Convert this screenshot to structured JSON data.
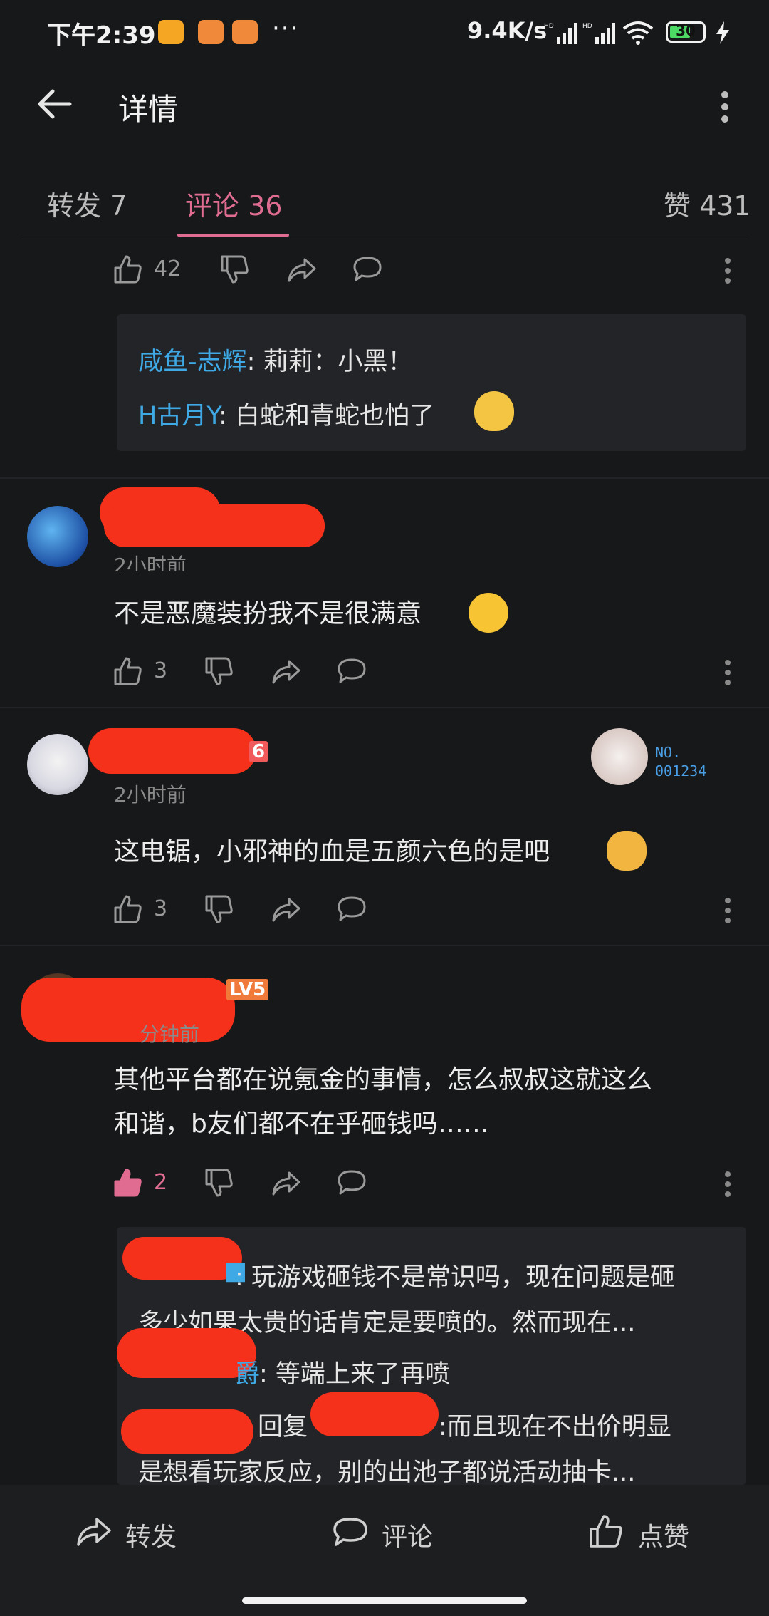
{
  "status_bar": {
    "time": "下午2:39",
    "dots": "···",
    "network_speed": "9.4K/s",
    "battery": "30"
  },
  "header": {
    "title": "详情",
    "back_icon": "arrow-left-icon",
    "more_icon": "more-vertical-icon"
  },
  "tabs": {
    "forward": "转发 7",
    "comments": "评论 36",
    "likes": "赞 431"
  },
  "top_comment": {
    "like_count": "42",
    "replies": [
      {
        "name": "咸鱼-志辉",
        "text": ": 莉莉：小黑！"
      },
      {
        "name": "H古月Y",
        "text": ": 白蛇和青蛇也怕了"
      }
    ]
  },
  "comments": [
    {
      "time": "2小时前",
      "time_visible_part": "2小时前",
      "text": "不是恶魔装扮我不是很满意",
      "like_count": "3",
      "liked": false
    },
    {
      "time": "2小时前",
      "level": "6",
      "badge_no": "NO.",
      "badge_id": "001234",
      "text": "这电锯，小邪神的血是五颜六色的是吧",
      "like_count": "3",
      "liked": false
    },
    {
      "time": "分钟前",
      "level": "LV5",
      "text_line1": "其他平台都在说氪金的事情，怎么叔叔这就这么",
      "text_line2": "和谐，b友们都不在乎砸钱吗……",
      "like_count": "2",
      "liked": true,
      "replies": [
        {
          "line1": ": 玩游戏砸钱不是常识吗，现在问题是砸",
          "line2": "多少如果太贵的话肯定是要喷的。然而现在..."
        },
        {
          "name_tail": "爵",
          "text": ": 等端上来了再喷"
        },
        {
          "prefix": "回复",
          "line1": ":而且现在不出价明显",
          "line2": "是想看玩家反应，别的出池子都说活动抽卡..."
        }
      ]
    }
  ],
  "bottom_bar": {
    "forward": "转发",
    "comment": "评论",
    "like": "点赞"
  },
  "colors": {
    "background": "#17181a",
    "accent_pink": "#e06d91",
    "name_blue": "#3fa9e6",
    "redaction": "#f5311b"
  }
}
